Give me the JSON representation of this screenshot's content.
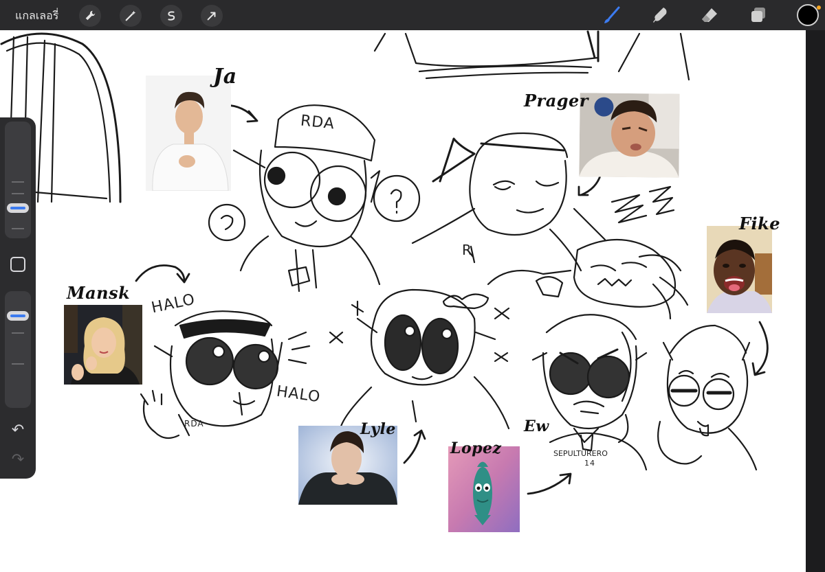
{
  "toolbar": {
    "gallery_label": "แกลเลอรี่",
    "left_tools": [
      {
        "icon": "wrench-icon"
      },
      {
        "icon": "magic-wand-icon"
      },
      {
        "icon": "selection-icon"
      },
      {
        "icon": "transform-arrow-icon"
      }
    ],
    "right_tools": [
      {
        "icon": "brush-icon",
        "active_color": "#3c7bf0"
      },
      {
        "icon": "smudge-icon"
      },
      {
        "icon": "eraser-icon"
      },
      {
        "icon": "layers-icon"
      }
    ],
    "current_color": "#000000"
  },
  "sidebar": {
    "brush_size_level": 0.3,
    "opacity_level": 0.17
  },
  "canvas": {
    "labels": {
      "ja": "Ja",
      "prager": "Prager",
      "fike": "Fike",
      "mansk": "Mansk",
      "lyle": "Lyle",
      "lopez": "Lopez",
      "ew": "Ew"
    },
    "doodle_text": {
      "cap": "RDA",
      "halo_top": "HALO",
      "halo_bottom": "HALO",
      "rda_small": "RDA",
      "shirt": "SEPULTURERO",
      "shirt_num": "14",
      "r_mark": "R"
    }
  }
}
